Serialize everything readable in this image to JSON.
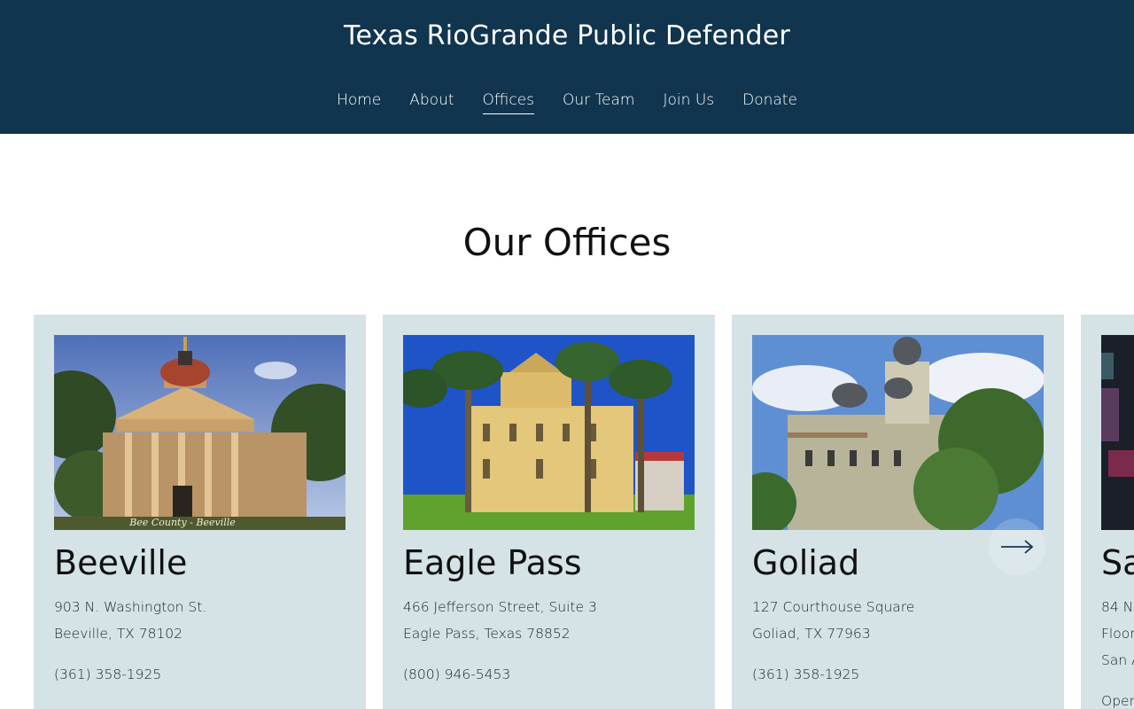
{
  "header": {
    "site_title": "Texas RioGrande Public Defender",
    "nav": [
      {
        "label": "Home"
      },
      {
        "label": "About"
      },
      {
        "label": "Offices",
        "active": true
      },
      {
        "label": "Our Team"
      },
      {
        "label": "Join Us"
      },
      {
        "label": "Donate"
      }
    ]
  },
  "main": {
    "heading": "Our Offices",
    "offices": [
      {
        "name": "Beeville",
        "photo_caption": "Bee County - Beeville",
        "address_line1": "903 N. Washington St.",
        "address_line2": "Beeville, TX 78102",
        "phone": "(361) 358-1925"
      },
      {
        "name": "Eagle Pass",
        "address_line1": "466 Jefferson Street, Suite 3",
        "address_line2": "Eagle Pass, Texas 78852",
        "phone": "(800) 946-5453"
      },
      {
        "name": "Goliad",
        "address_line1": "127 Courthouse Square",
        "address_line2": "Goliad, TX  77963",
        "phone": "(361) 358-1925"
      },
      {
        "name": "Sa",
        "address_line1": "84 Na",
        "address_line2": "Floor",
        "address_line3": "San A",
        "extra": "Oper"
      }
    ],
    "carousel": {
      "next_icon": "arrow-right-icon"
    }
  },
  "colors": {
    "header_bg": "#11354f",
    "card_bg": "#d5e3e7",
    "text": "#111111"
  }
}
